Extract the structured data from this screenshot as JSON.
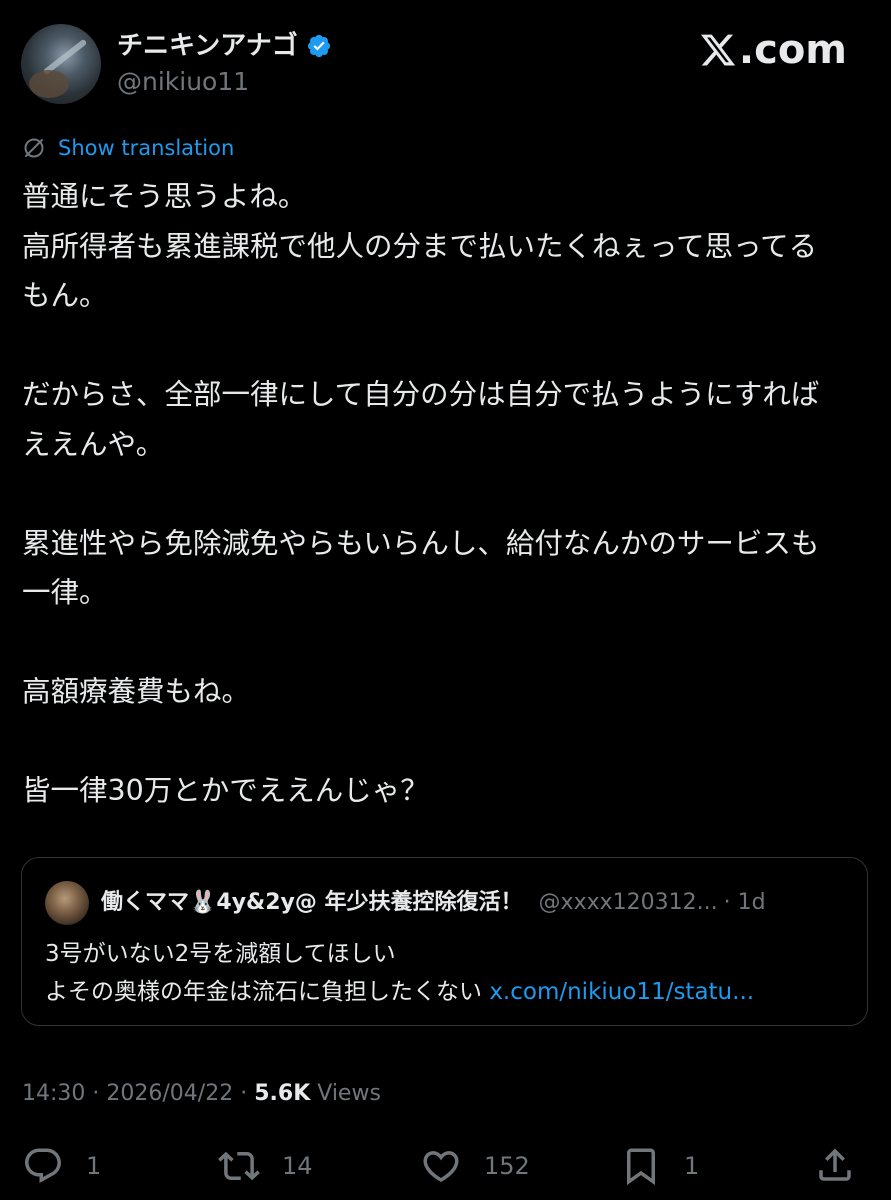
{
  "author": {
    "display_name": "チニキンアナゴ",
    "handle": "@nikiuo11",
    "verified": true
  },
  "watermark": {
    "text": ".com",
    "icon": "x-logo-icon"
  },
  "translate": {
    "label": "Show translation",
    "icon": "globe-slash-icon"
  },
  "tweet": {
    "text": "普通にそう思うよね。\n高所得者も累進課税で他人の分まで払いたくねぇって思ってる\nもん。\n\nだからさ、全部一律にして自分の分は自分で払うようにすれば\nええんや。\n\n累進性やら免除減免やらもいらんし、給付なんかのサービスも\n一律。\n\n高額療養費もね。\n\n皆一律30万とかでええんじゃ？"
  },
  "quote": {
    "display_name": "働くママ🐰4y&2y@ 年少扶養控除復活！",
    "handle": "@xxxx120312...",
    "time": "· 1d",
    "line1": "3号がいない2号を減額してほしい",
    "line2": "よその奥様の年金は流石に負担したくない",
    "link": "x.com/nikiuo11/statu..."
  },
  "meta": {
    "time": "14:30",
    "date": "2026/04/22",
    "views_count": "5.6K",
    "views_label": "Views"
  },
  "actions": {
    "replies": "1",
    "reposts": "14",
    "likes": "152",
    "bookmarks": "1"
  },
  "colors": {
    "background": "#000000",
    "text": "#e7e9ea",
    "secondary": "#71767b",
    "accent": "#1d9bf0",
    "border": "#2f3336"
  }
}
